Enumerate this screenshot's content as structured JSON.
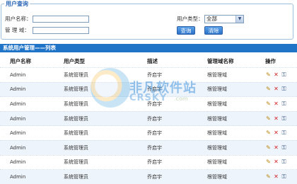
{
  "search": {
    "legend": "用户查询",
    "username_label": "用户名称：",
    "username_value": "",
    "domain_label": "管 理 域：",
    "domain_value": "",
    "usertype_label": "用户类型：",
    "usertype_selected": "全部",
    "query_button": "查询",
    "reset_button": "清除"
  },
  "list": {
    "title": "系统用户管理——列表",
    "columns": [
      "用户名称",
      "用户类型",
      "描述",
      "管理域名称",
      "操作"
    ],
    "rows": [
      {
        "name": "Admin",
        "type": "系统管理员",
        "desc": "乔启宇",
        "domain": "根管理域"
      },
      {
        "name": "Admin",
        "type": "系统管理员",
        "desc": "乔启宇",
        "domain": "根管理域"
      },
      {
        "name": "Admin",
        "type": "系统管理员",
        "desc": "乔启宇",
        "domain": "根管理域"
      },
      {
        "name": "Admin",
        "type": "系统管理员",
        "desc": "乔启宇",
        "domain": "根管理域"
      },
      {
        "name": "Admin",
        "type": "系统管理员",
        "desc": "乔启宇",
        "domain": "根管理域"
      },
      {
        "name": "Admin",
        "type": "系统管理员",
        "desc": "乔启宇",
        "domain": "根管理域"
      },
      {
        "name": "Admin",
        "type": "系统管理员",
        "desc": "乔启宇",
        "domain": "根管理域"
      },
      {
        "name": "Admin",
        "type": "系统管理员",
        "desc": "乔启宇",
        "domain": "根管理域"
      }
    ],
    "actions": {
      "edit_icon": "pencil-icon",
      "delete_icon": "delete-x-icon",
      "permission_icon": "key-icon"
    }
  },
  "watermark": {
    "text": "非凡软件站",
    "sub": "CRSKY",
    "domain": ".com"
  },
  "colors": {
    "accent": "#1f74c8",
    "button": "#2b72c9",
    "row_alt": "#eef4fb",
    "delete": "#d21f1f"
  }
}
